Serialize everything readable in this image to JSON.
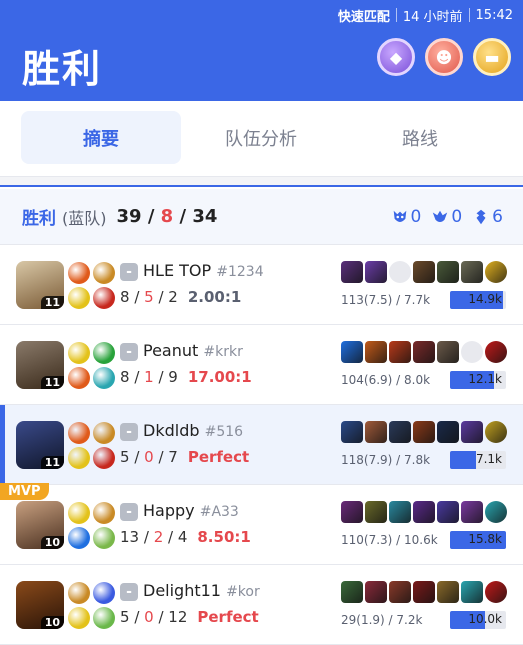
{
  "statusbar": {
    "mode": "快速匹配",
    "time_ago": "14 小时前",
    "duration": "15:42"
  },
  "header": {
    "title": "胜利",
    "badges": [
      "purple-rank-emblem-icon",
      "red-multikill-emblem-icon",
      "gold-emblem-icon"
    ]
  },
  "tabs": [
    {
      "label": "摘要",
      "active": true
    },
    {
      "label": "队伍分析",
      "active": false
    },
    {
      "label": "路线",
      "active": false
    }
  ],
  "summary": {
    "result": "胜利",
    "team": "(蓝队)",
    "kills": "39",
    "deaths": "8",
    "assists": "34",
    "objectives": [
      {
        "icon": "baron-icon",
        "value": "0"
      },
      {
        "icon": "dragon-icon",
        "value": "0"
      },
      {
        "icon": "tower-icon",
        "value": "6"
      }
    ]
  },
  "players": [
    {
      "name": "HLE TOP",
      "tag": "#1234",
      "level": "11",
      "mvp": "",
      "k": "8",
      "d": "5",
      "a": "2",
      "kda": "2.00:1",
      "kda_hot": false,
      "gold": "113(7.5) / 7.7k",
      "damage": "14.9k",
      "damage_fraction": 0.94,
      "champ_colors": [
        "#d8c7a6",
        "#7a5a35"
      ],
      "spells": [
        "#e05a1a",
        "#c98a25",
        "#e3c21a",
        "#c7281e"
      ],
      "items": [
        "#5a2f7c",
        "#6b3da8",
        "empty",
        "#6b4a2a",
        "#4a5a3a",
        "#6a6a55",
        "#e0b020"
      ]
    },
    {
      "name": "Peanut",
      "tag": "#krkr",
      "level": "11",
      "mvp": "",
      "k": "8",
      "d": "1",
      "a": "9",
      "kda": "17.00:1",
      "kda_hot": true,
      "gold": "104(6.9) / 8.0k",
      "damage": "12.1k",
      "damage_fraction": 0.78,
      "champ_colors": [
        "#8a7a6a",
        "#3a2a1a"
      ],
      "spells": [
        "#e3c21a",
        "#28a23a",
        "#e05a1a",
        "#2aa6b0"
      ],
      "items": [
        "#1f6fe0",
        "#c25a1a",
        "#b83a1a",
        "#7a2a2a",
        "#6b5a4a",
        "empty",
        "#c01a1a"
      ]
    },
    {
      "name": "Dkdldb",
      "tag": "#516",
      "level": "11",
      "mvp": "",
      "k": "5",
      "d": "0",
      "a": "7",
      "kda": "Perfect",
      "kda_hot": true,
      "gold": "118(7.9) / 7.8k",
      "damage": "7.1k",
      "damage_fraction": 0.46,
      "champ_colors": [
        "#3a4a8a",
        "#10162a"
      ],
      "spells": [
        "#e05a1a",
        "#c98a25",
        "#e3c21a",
        "#c7281e"
      ],
      "items": [
        "#2a4a8a",
        "#a05a3a",
        "#2a3a5a",
        "#8a3a1a",
        "#1a2a4a",
        "#5a3aa0",
        "#c0a020"
      ]
    },
    {
      "name": "Happy",
      "tag": "#A33",
      "level": "10",
      "mvp": "MVP",
      "k": "13",
      "d": "2",
      "a": "4",
      "kda": "8.50:1",
      "kda_hot": true,
      "gold": "110(7.3) / 10.6k",
      "damage": "15.8k",
      "damage_fraction": 1.0,
      "champ_colors": [
        "#c8a080",
        "#4a3020"
      ],
      "spells": [
        "#e3c21a",
        "#c98a25",
        "#1f6fe0",
        "#7ab84a"
      ],
      "items": [
        "#6a2a7a",
        "#6a6a2a",
        "#2a8aa0",
        "#5a2a8a",
        "#4a3aa0",
        "#7a3aa0",
        "#2aa6b0"
      ]
    },
    {
      "name": "Delight11",
      "tag": "#kor",
      "level": "10",
      "mvp": "",
      "k": "5",
      "d": "0",
      "a": "12",
      "kda": "Perfect",
      "kda_hot": true,
      "gold": "29(1.9) / 7.2k",
      "damage": "10.0k",
      "damage_fraction": 0.62,
      "champ_colors": [
        "#8a4a1a",
        "#2a1408"
      ],
      "spells": [
        "#c98a25",
        "#3a5ae0",
        "#e3c21a",
        "#6ab84a"
      ],
      "items": [
        "#3a6a3a",
        "#8a2a3a",
        "#8a3a2a",
        "#7a1a1a",
        "#8a6a2a",
        "#2aa6b0",
        "#c01a1a"
      ]
    }
  ]
}
